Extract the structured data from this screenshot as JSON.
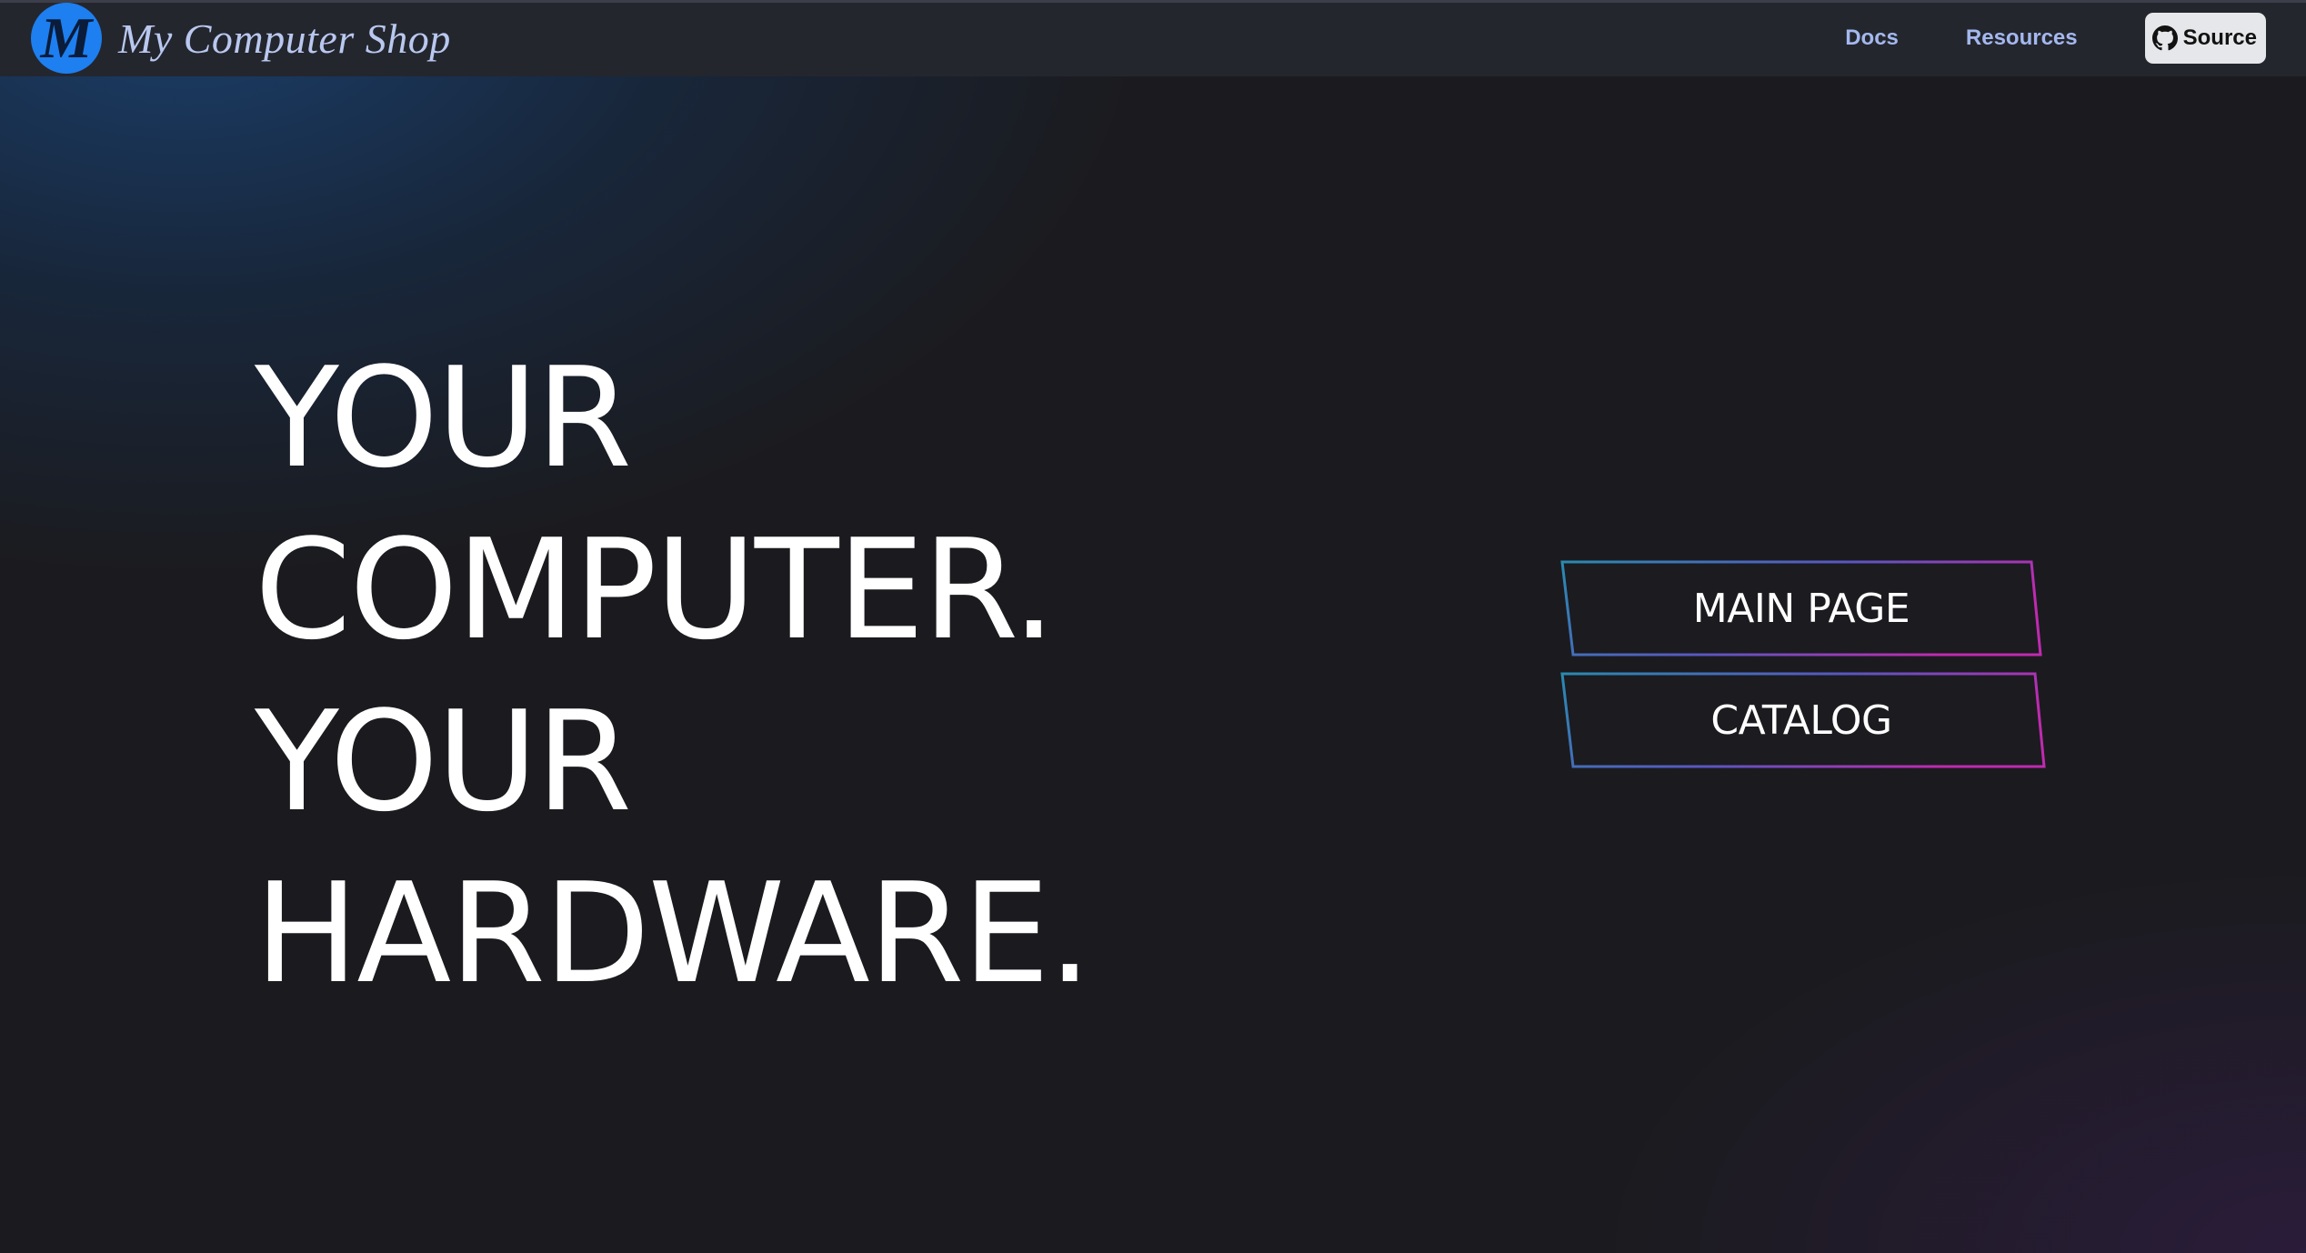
{
  "navbar": {
    "brand_name": "My Computer Shop",
    "logo_letter": "M",
    "links": {
      "docs": "Docs",
      "resources": "Resources"
    },
    "source_button": {
      "label": "Source",
      "icon": "github-icon"
    }
  },
  "hero": {
    "line1": "YOUR",
    "line2": "COMPUTER.",
    "line3": "YOUR",
    "line4": "HARDWARE."
  },
  "actions": {
    "main_page": "MAIN PAGE",
    "catalog": "CATALOG"
  },
  "colors": {
    "navbar_bg": "#24262e",
    "page_bg": "#1b1b1f",
    "logo_blue": "#1d7ff0",
    "nav_link": "#a4b8ee",
    "button_gradient_start": "#2a8ab0",
    "button_gradient_end": "#c02ab0"
  }
}
